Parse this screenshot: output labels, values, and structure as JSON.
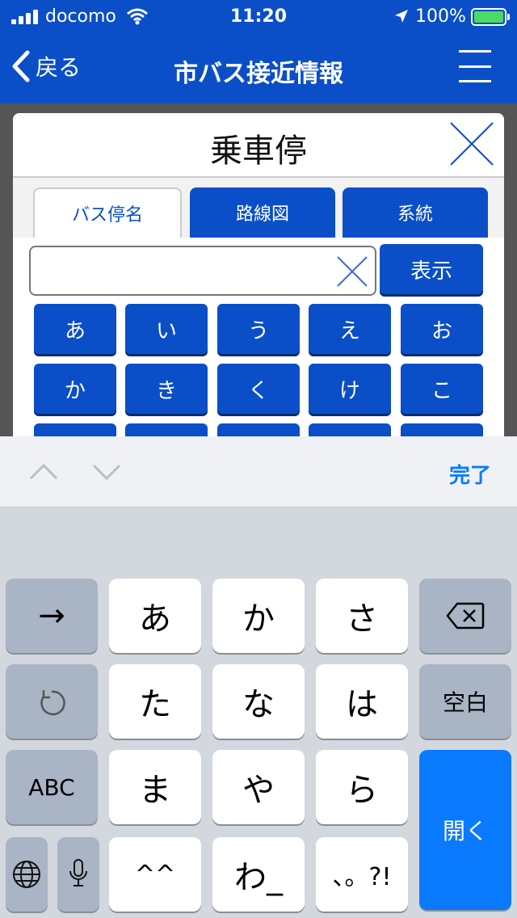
{
  "status": {
    "carrier": "docomo",
    "time": "11:20",
    "battery": "100%"
  },
  "nav": {
    "back_label": "戻る",
    "title": "市バス接近情報"
  },
  "modal": {
    "title": "乗車停",
    "tabs": [
      {
        "label": "バス停名"
      },
      {
        "label": "路線図"
      },
      {
        "label": "系統"
      }
    ],
    "show_label": "表示",
    "kana_row1": [
      "あ",
      "い",
      "う",
      "え",
      "お"
    ],
    "kana_row2": [
      "か",
      "き",
      "く",
      "け",
      "こ"
    ]
  },
  "toolbar": {
    "done_label": "完了"
  },
  "keyboard": {
    "r1": [
      "あ",
      "か",
      "さ"
    ],
    "r2": [
      "た",
      "な",
      "は"
    ],
    "r3": [
      "ま",
      "や",
      "ら"
    ],
    "r4": [
      "^^",
      "わ_",
      "、。?!"
    ],
    "space": "空白",
    "abc": "ABC",
    "enter": "開く",
    "arrow": "→"
  }
}
